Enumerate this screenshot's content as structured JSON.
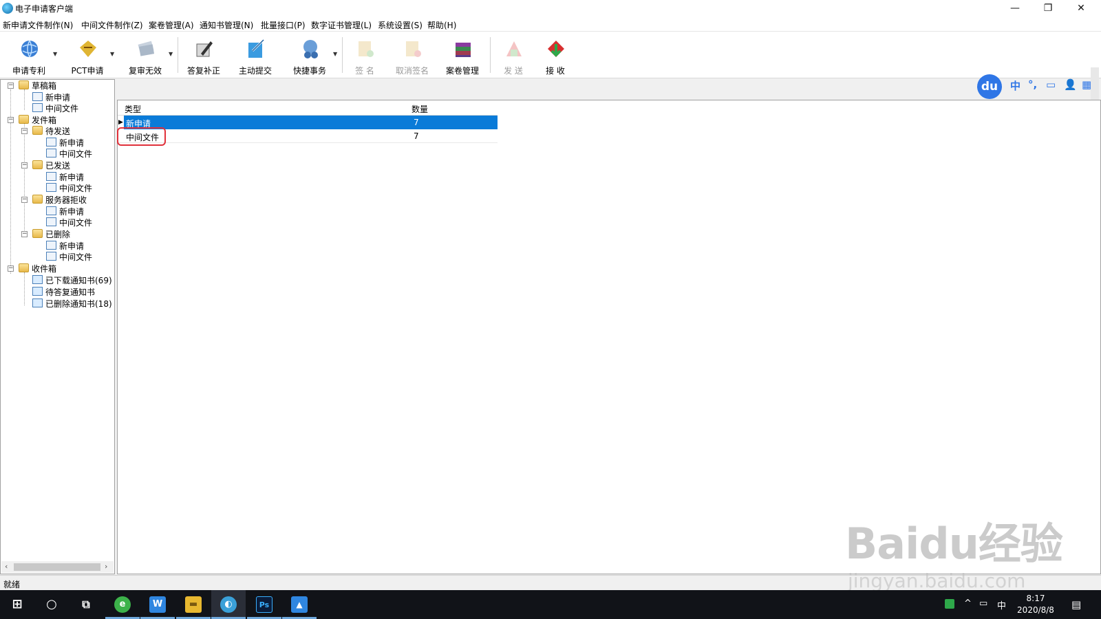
{
  "window": {
    "title": "电子申请客户端",
    "minimize": "—",
    "restore": "❐",
    "close": "✕"
  },
  "menu": [
    "新申请文件制作(N)",
    "中间文件制作(Z)",
    "案卷管理(A)",
    "通知书管理(N)",
    "批量接口(P)",
    "数字证书管理(L)",
    "系统设置(S)",
    "帮助(H)"
  ],
  "toolbar": {
    "buttons": [
      {
        "label": "申请专利",
        "icon": "globe-icon",
        "enabled": true,
        "dropdown": true
      },
      {
        "label": "PCT申请",
        "icon": "pct-icon",
        "enabled": true,
        "dropdown": true
      },
      {
        "label": "复审无效",
        "icon": "document-stack-icon",
        "enabled": true,
        "dropdown": true
      },
      {
        "label": "答复补正",
        "icon": "pen-document-icon",
        "enabled": true,
        "dropdown": false
      },
      {
        "label": "主动提交",
        "icon": "submit-icon",
        "enabled": true,
        "dropdown": false
      },
      {
        "label": "快捷事务",
        "icon": "quick-task-icon",
        "enabled": true,
        "dropdown": true
      },
      {
        "label": "签 名",
        "icon": "sign-icon",
        "enabled": false,
        "dropdown": false
      },
      {
        "label": "取消签名",
        "icon": "cancel-sign-icon",
        "enabled": false,
        "dropdown": false
      },
      {
        "label": "案卷管理",
        "icon": "books-icon",
        "enabled": true,
        "dropdown": false
      },
      {
        "label": "发 送",
        "icon": "send-icon",
        "enabled": false,
        "dropdown": false
      },
      {
        "label": "接 收",
        "icon": "receive-icon",
        "enabled": true,
        "dropdown": false
      }
    ]
  },
  "ime": {
    "logo": "du",
    "items": [
      "中",
      "°,",
      "▭",
      "👤",
      "▦"
    ]
  },
  "tree": {
    "draft": {
      "label": "草稿箱",
      "children": [
        "新申请",
        "中间文件"
      ]
    },
    "outbox": {
      "label": "发件箱",
      "groups": [
        {
          "label": "待发送",
          "children": [
            "新申请",
            "中间文件"
          ]
        },
        {
          "label": "已发送",
          "children": [
            "新申请",
            "中间文件"
          ]
        },
        {
          "label": "服务器拒收",
          "children": [
            "新申请",
            "中间文件"
          ]
        },
        {
          "label": "已删除",
          "children": [
            "新申请",
            "中间文件"
          ]
        }
      ]
    },
    "inbox": {
      "label": "收件箱",
      "children": [
        "已下载通知书(69)",
        "待答复通知书",
        "已删除通知书(18)"
      ]
    },
    "scroll_left": "‹",
    "scroll_right": "›"
  },
  "grid": {
    "columns": [
      "类型",
      "数量"
    ],
    "rows": [
      {
        "type": "新申请",
        "count": "7",
        "selected": true
      },
      {
        "type": "中间文件",
        "count": "7",
        "selected": false
      }
    ]
  },
  "status": {
    "text": "就绪"
  },
  "watermark": {
    "logo": "Baidu经验",
    "url": "jingyan.baidu.com"
  },
  "taskbar": {
    "apps": [
      {
        "name": "start",
        "glyph": "⊞"
      },
      {
        "name": "search",
        "glyph": "○"
      },
      {
        "name": "task-view",
        "glyph": "⧉"
      },
      {
        "name": "browser",
        "glyph": "e"
      },
      {
        "name": "wps",
        "glyph": "W"
      },
      {
        "name": "explorer",
        "glyph": "▬"
      },
      {
        "name": "e-filing",
        "glyph": "◐"
      },
      {
        "name": "photoshop",
        "glyph": "Ps"
      },
      {
        "name": "photos",
        "glyph": "▲"
      }
    ],
    "tray": {
      "up": "^",
      "net": "▭",
      "lang": "中"
    },
    "time": "8:17",
    "date": "2020/8/8",
    "notification": "▤"
  }
}
